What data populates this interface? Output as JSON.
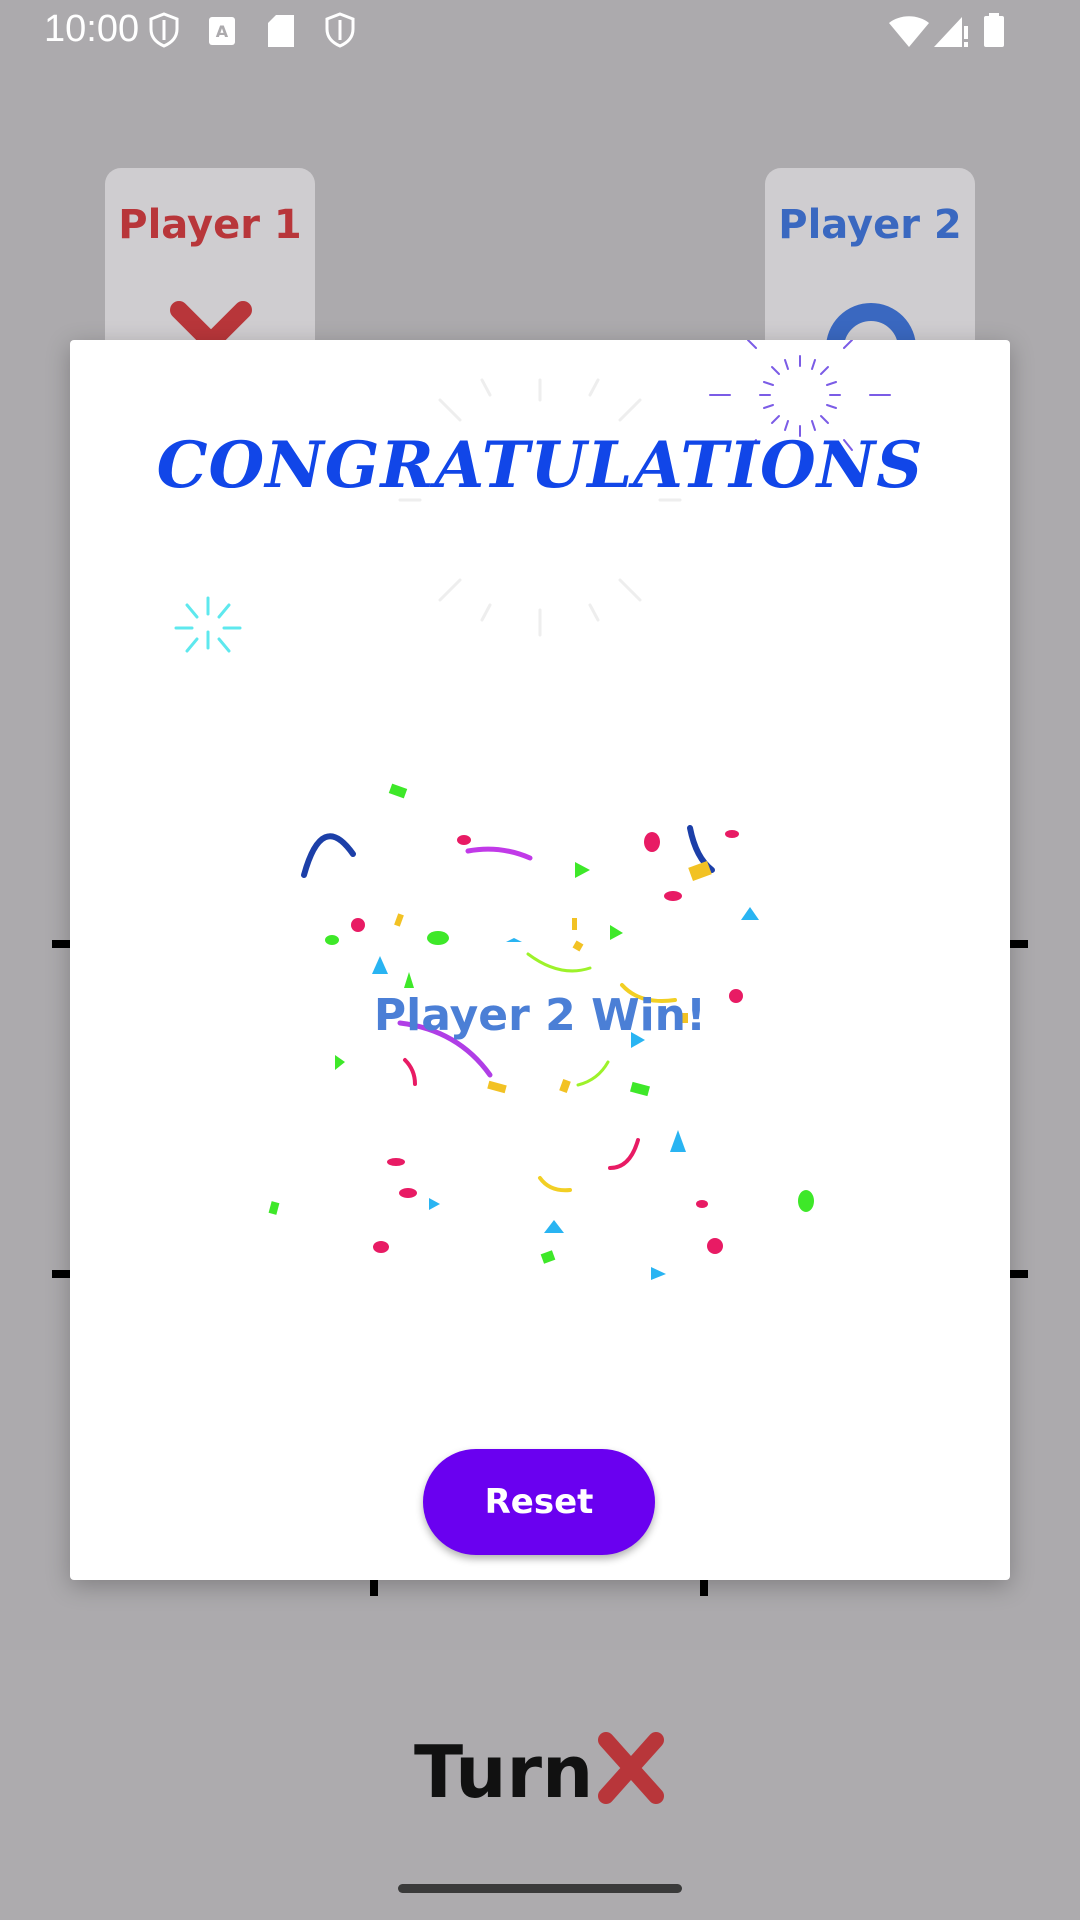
{
  "status_bar": {
    "time": "10:00"
  },
  "players": [
    {
      "name": "Player 1",
      "symbol_icon": "x-icon",
      "color": "#b8363a"
    },
    {
      "name": "Player 2",
      "symbol_icon": "o-icon",
      "color": "#3a68c0"
    }
  ],
  "turn": {
    "label": "Turn",
    "symbol_icon": "x-icon",
    "color": "#b8363a"
  },
  "dialog": {
    "title": "CONGRATULATIONS",
    "message": "Player 2 Win!",
    "reset_label": "Reset"
  },
  "colors": {
    "scrim": "#acaaad",
    "title": "#1146e8",
    "message": "#4b7fd6",
    "button": "#6a00f0"
  }
}
